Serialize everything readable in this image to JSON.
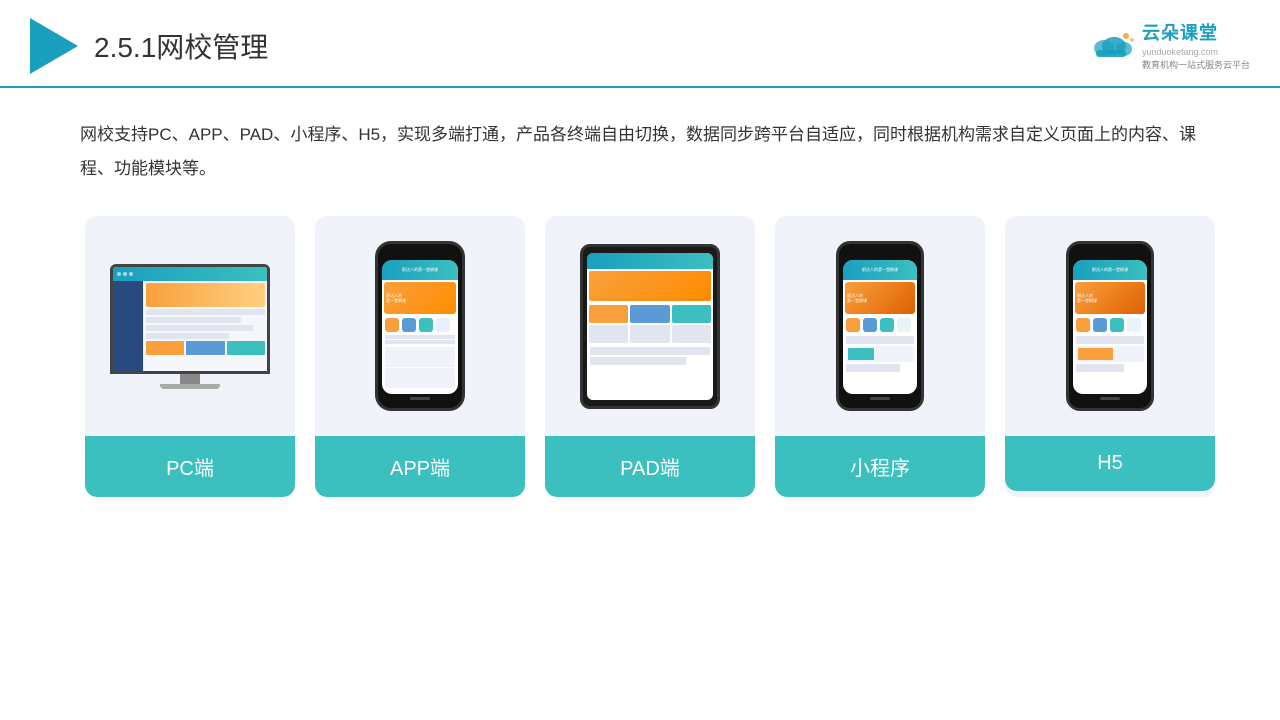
{
  "header": {
    "title_prefix": "2.5.1",
    "title_main": "网校管理",
    "brand_name": "云朵课堂",
    "brand_domain": "yunduoketang.com",
    "brand_tagline": "教育机构一站",
    "brand_tagline2": "式服务云平台"
  },
  "description": {
    "text": "网校支持PC、APP、PAD、小程序、H5，实现多端打通，产品各终端自由切换，数据同步跨平台自适应，同时根据机构需求自定义页面上的内容、课程、功能模块等。"
  },
  "cards": [
    {
      "id": "pc",
      "label": "PC端"
    },
    {
      "id": "app",
      "label": "APP端"
    },
    {
      "id": "pad",
      "label": "PAD端"
    },
    {
      "id": "miniprogram",
      "label": "小程序"
    },
    {
      "id": "h5",
      "label": "H5"
    }
  ],
  "colors": {
    "accent": "#3bbfbf",
    "header_line": "#1a9fbf",
    "text_dark": "#333333",
    "card_bg": "#edf2f8"
  }
}
